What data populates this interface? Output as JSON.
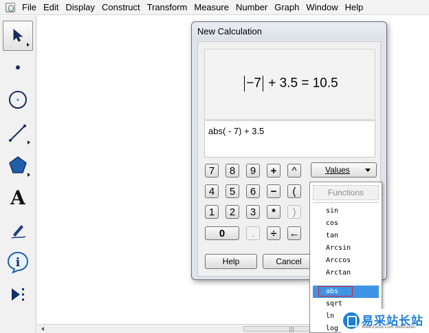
{
  "menubar": {
    "items": [
      "File",
      "Edit",
      "Display",
      "Construct",
      "Transform",
      "Measure",
      "Number",
      "Graph",
      "Window",
      "Help"
    ]
  },
  "toolbox": {
    "tools": [
      {
        "name": "arrow-tool",
        "icon": "arrow-icon",
        "selected": true
      },
      {
        "name": "point-tool",
        "icon": "point-icon"
      },
      {
        "name": "compass-tool",
        "icon": "circle-icon"
      },
      {
        "name": "straightedge-tool",
        "icon": "segment-icon"
      },
      {
        "name": "polygon-tool",
        "icon": "polygon-icon"
      },
      {
        "name": "text-tool",
        "icon": "text-icon",
        "glyph": "A"
      },
      {
        "name": "marker-tool",
        "icon": "marker-icon"
      },
      {
        "name": "information-tool",
        "icon": "info-icon",
        "glyph": "i"
      },
      {
        "name": "custom-tool",
        "icon": "custom-tool-icon"
      }
    ]
  },
  "dialog": {
    "title": "New Calculation",
    "expression": {
      "abs_inner": "−7",
      "tail": "+ 3.5 = 10.5"
    },
    "input_value": "abs( - 7) + 3.5",
    "keypad": {
      "row1": [
        "7",
        "8",
        "9",
        "+",
        "^"
      ],
      "row2": [
        "4",
        "5",
        "6",
        "−",
        "("
      ],
      "row3": [
        "1",
        "2",
        "3",
        "*",
        ")"
      ],
      "row4": [
        "0",
        ".",
        "÷",
        "←"
      ]
    },
    "values_label": "Values",
    "help_label": "Help",
    "cancel_label": "Cancel"
  },
  "functions_menu": {
    "header": "Functions",
    "items": [
      "sin",
      "cos",
      "tan",
      "Arcsin",
      "Arccos",
      "Arctan"
    ],
    "items_below": [
      "abs",
      "sqrt",
      "ln",
      "log"
    ],
    "highlighted": "abs"
  },
  "watermark": {
    "title": "易采站长站",
    "subtitle": "Www.Easck.Com Webmaster"
  },
  "colors": {
    "highlight": "#3d95e6",
    "highlight_box": "#e02020",
    "watermark_blue": "#1c7fd8"
  }
}
